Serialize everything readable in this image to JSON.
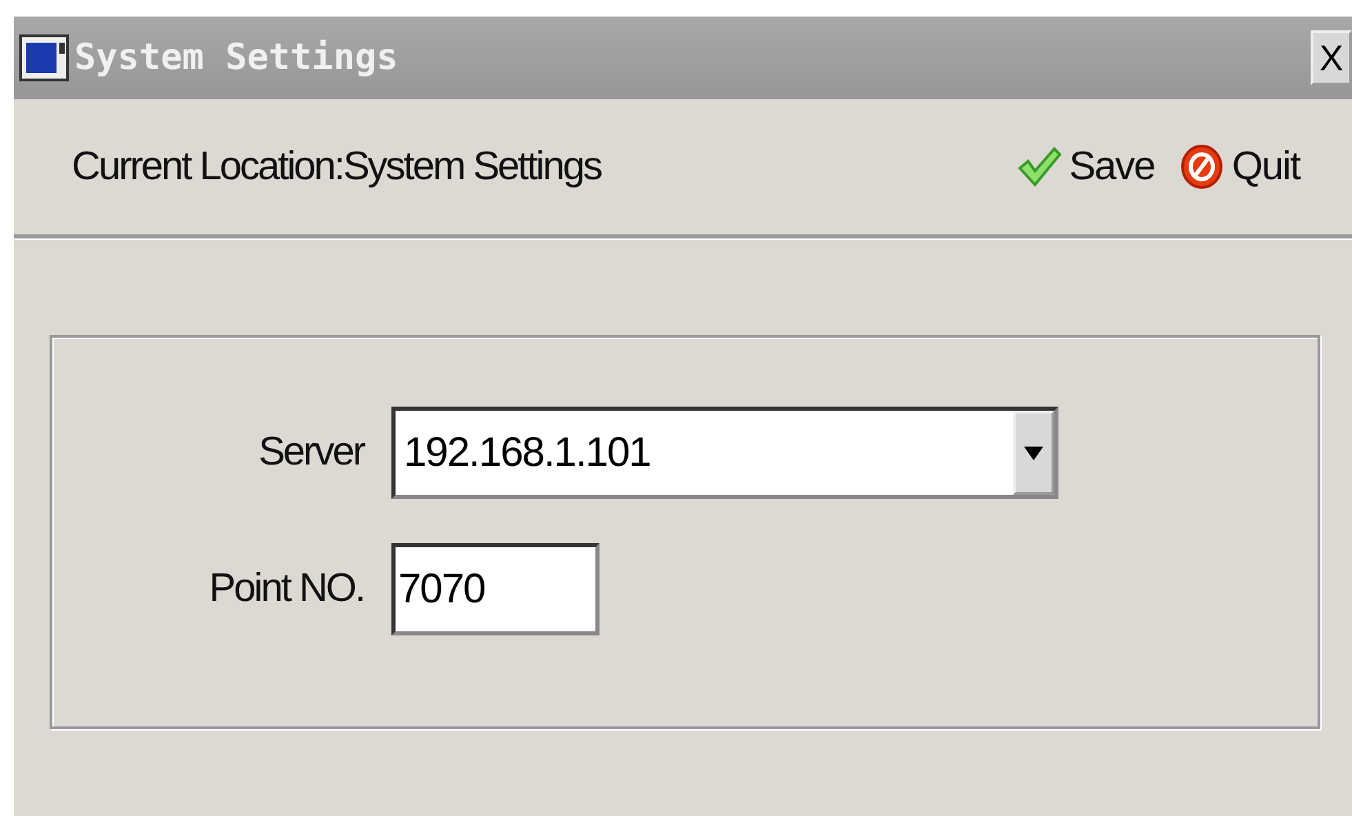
{
  "window": {
    "title": "System Settings",
    "close_label": "X"
  },
  "toolbar": {
    "location": "Current Location:System Settings",
    "actions": [
      {
        "kind": "save",
        "label": "Save"
      },
      {
        "kind": "quit",
        "label": "Quit"
      }
    ]
  },
  "form": {
    "fields": [
      {
        "kind": "combo",
        "label": "Server",
        "value": "192.168.1.101"
      },
      {
        "kind": "text",
        "label": "Point NO.",
        "value": "7070"
      }
    ]
  }
}
